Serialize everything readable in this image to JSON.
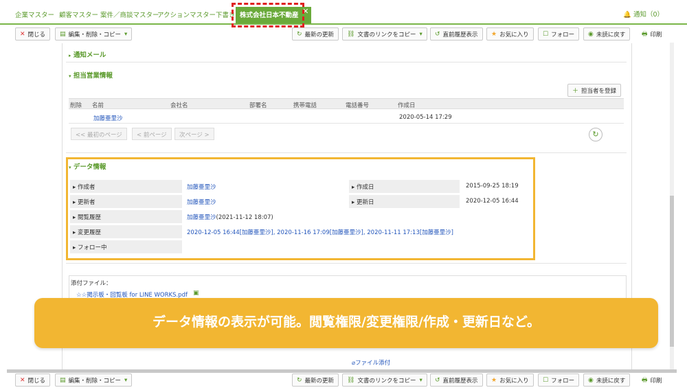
{
  "nav": {
    "tabs": [
      "企業マスター",
      "顧客マスター",
      "案件／商談マスター",
      "アクションマスター",
      "下書き"
    ],
    "active_tab": "株式会社日本不動産",
    "close_glyph": "✕",
    "notice": "通知（0）"
  },
  "toolbar": {
    "close": "閉じる",
    "edit_menu": "編集・削除・コピー",
    "refresh": "最新の更新",
    "copy_link": "文書のリンクをコピー",
    "history": "直前履歴表示",
    "favorite": "お気に入り",
    "follow": "フォロー",
    "mark_unread": "未読に戻す",
    "print": "印刷"
  },
  "sections": {
    "notify_mail": "通知メール",
    "sales_info": "担当営業情報",
    "add_person": "担当者を登録",
    "data_info": "データ情報"
  },
  "table": {
    "headers": [
      "削除",
      "名前",
      "会社名",
      "部署名",
      "携帯電話",
      "電話番号",
      "作成日"
    ],
    "rows": [
      {
        "name": "加藤亜里沙",
        "created": "2020-05-14 17:29"
      }
    ]
  },
  "pager": {
    "first": "<< 最初のページ",
    "prev": "< 前ページ",
    "next": "次ページ >"
  },
  "data_info": {
    "creator_label": "作成者",
    "creator": "加藤亜里沙",
    "created_label": "作成日",
    "created": "2015-09-25 18:19",
    "updater_label": "更新者",
    "updater": "加藤亜里沙",
    "updated_label": "更新日",
    "updated": "2020-12-05 16:44",
    "view_label": "閲覧履歴",
    "view_name": "加藤亜里沙",
    "view_time": "(2021-11-12 18:07)",
    "change_label": "変更履歴",
    "change_history": "2020-12-05 16:44[加藤亜里沙], 2020-11-16 17:09[加藤亜里沙], 2020-11-11 17:13[加藤亜里沙]",
    "following_label": "フォロー中"
  },
  "attachments": {
    "label": "添付ファイル：",
    "file": "☆☆掲示板・回覧板 for LINE WORKS.pdf",
    "add": "ファイル添付"
  },
  "banner": "データ情報の表示が可能。閲覧権限/変更権限/作成・更新日など。",
  "colors": {
    "brand_green": "#6aaa3a",
    "highlight_red": "#e02020",
    "highlight_yellow": "#f2b632",
    "link_blue": "#2255bb"
  }
}
